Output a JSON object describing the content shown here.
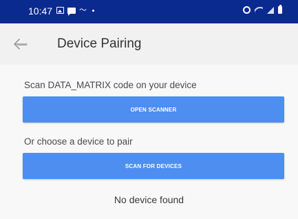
{
  "status_bar": {
    "time": "10:47",
    "background_color": "#0b2a8f",
    "left_icons": [
      "gallery-icon",
      "message-icon",
      "wave-icon",
      "dot-icon"
    ],
    "right_icons": [
      "alarm-icon",
      "wifi-icon",
      "signal-icon",
      "battery-icon"
    ]
  },
  "app_bar": {
    "back_icon": "arrow-left-icon",
    "title": "Device Pairing"
  },
  "scan_section": {
    "label": "Scan DATA_MATRIX code on your device",
    "button_label": "OPEN SCANNER"
  },
  "choose_section": {
    "label": "Or choose a device to pair",
    "button_label": "SCAN FOR DEVICES"
  },
  "device_list": {
    "empty_text": "No device found"
  },
  "colors": {
    "accent": "#4d8ef0",
    "status_bar": "#0b2a8f"
  }
}
